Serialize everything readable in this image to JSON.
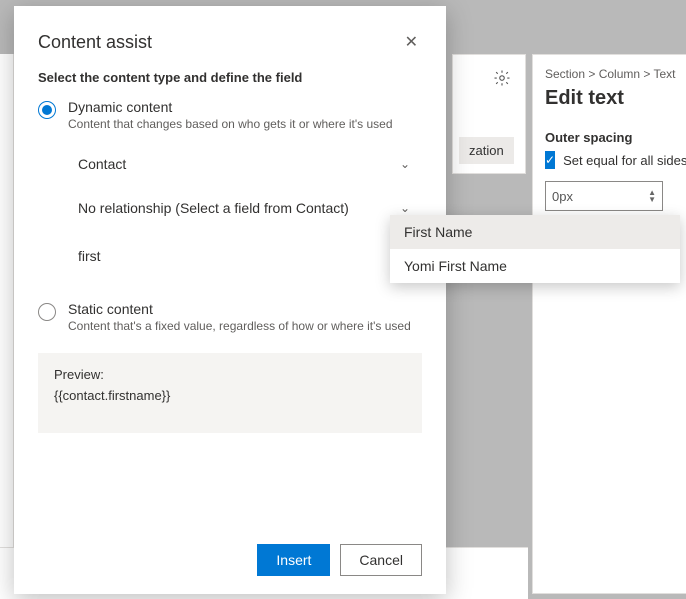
{
  "dialog": {
    "title": "Content assist",
    "subtitle": "Select the content type and define the field",
    "options": {
      "dynamic": {
        "label": "Dynamic content",
        "desc": "Content that changes based on who gets it or where it's used",
        "select_entity": "Contact",
        "select_relation": "No relationship (Select a field from Contact)",
        "field_input": "first"
      },
      "static": {
        "label": "Static content",
        "desc": "Content that's a fixed value, regardless of how or where it's used"
      }
    },
    "preview": {
      "label": "Preview:",
      "value": "{{contact.firstname}}"
    },
    "buttons": {
      "insert": "Insert",
      "cancel": "Cancel"
    }
  },
  "dropdown": {
    "item1": "First Name",
    "item2": "Yomi First Name"
  },
  "panel": {
    "breadcrumb": "Section  >  Column  >  Text",
    "heading": "Edit text",
    "outer_spacing_label": "Outer spacing",
    "equal_sides": "Set equal for all sides",
    "spin_value": "0px"
  },
  "bg_tab": "zation"
}
